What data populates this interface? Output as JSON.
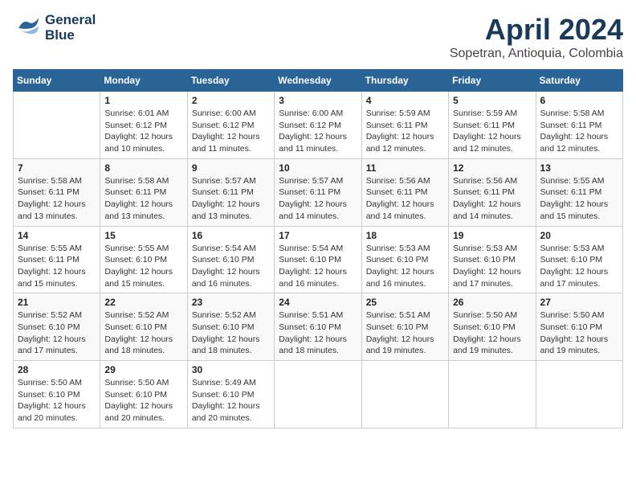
{
  "header": {
    "logo_line1": "General",
    "logo_line2": "Blue",
    "title": "April 2024",
    "subtitle": "Sopetran, Antioquia, Colombia"
  },
  "calendar": {
    "days_of_week": [
      "Sunday",
      "Monday",
      "Tuesday",
      "Wednesday",
      "Thursday",
      "Friday",
      "Saturday"
    ],
    "weeks": [
      [
        {
          "day": "",
          "info": ""
        },
        {
          "day": "1",
          "info": "Sunrise: 6:01 AM\nSunset: 6:12 PM\nDaylight: 12 hours\nand 10 minutes."
        },
        {
          "day": "2",
          "info": "Sunrise: 6:00 AM\nSunset: 6:12 PM\nDaylight: 12 hours\nand 11 minutes."
        },
        {
          "day": "3",
          "info": "Sunrise: 6:00 AM\nSunset: 6:12 PM\nDaylight: 12 hours\nand 11 minutes."
        },
        {
          "day": "4",
          "info": "Sunrise: 5:59 AM\nSunset: 6:11 PM\nDaylight: 12 hours\nand 12 minutes."
        },
        {
          "day": "5",
          "info": "Sunrise: 5:59 AM\nSunset: 6:11 PM\nDaylight: 12 hours\nand 12 minutes."
        },
        {
          "day": "6",
          "info": "Sunrise: 5:58 AM\nSunset: 6:11 PM\nDaylight: 12 hours\nand 12 minutes."
        }
      ],
      [
        {
          "day": "7",
          "info": "Sunrise: 5:58 AM\nSunset: 6:11 PM\nDaylight: 12 hours\nand 13 minutes."
        },
        {
          "day": "8",
          "info": "Sunrise: 5:58 AM\nSunset: 6:11 PM\nDaylight: 12 hours\nand 13 minutes."
        },
        {
          "day": "9",
          "info": "Sunrise: 5:57 AM\nSunset: 6:11 PM\nDaylight: 12 hours\nand 13 minutes."
        },
        {
          "day": "10",
          "info": "Sunrise: 5:57 AM\nSunset: 6:11 PM\nDaylight: 12 hours\nand 14 minutes."
        },
        {
          "day": "11",
          "info": "Sunrise: 5:56 AM\nSunset: 6:11 PM\nDaylight: 12 hours\nand 14 minutes."
        },
        {
          "day": "12",
          "info": "Sunrise: 5:56 AM\nSunset: 6:11 PM\nDaylight: 12 hours\nand 14 minutes."
        },
        {
          "day": "13",
          "info": "Sunrise: 5:55 AM\nSunset: 6:11 PM\nDaylight: 12 hours\nand 15 minutes."
        }
      ],
      [
        {
          "day": "14",
          "info": "Sunrise: 5:55 AM\nSunset: 6:11 PM\nDaylight: 12 hours\nand 15 minutes."
        },
        {
          "day": "15",
          "info": "Sunrise: 5:55 AM\nSunset: 6:10 PM\nDaylight: 12 hours\nand 15 minutes."
        },
        {
          "day": "16",
          "info": "Sunrise: 5:54 AM\nSunset: 6:10 PM\nDaylight: 12 hours\nand 16 minutes."
        },
        {
          "day": "17",
          "info": "Sunrise: 5:54 AM\nSunset: 6:10 PM\nDaylight: 12 hours\nand 16 minutes."
        },
        {
          "day": "18",
          "info": "Sunrise: 5:53 AM\nSunset: 6:10 PM\nDaylight: 12 hours\nand 16 minutes."
        },
        {
          "day": "19",
          "info": "Sunrise: 5:53 AM\nSunset: 6:10 PM\nDaylight: 12 hours\nand 17 minutes."
        },
        {
          "day": "20",
          "info": "Sunrise: 5:53 AM\nSunset: 6:10 PM\nDaylight: 12 hours\nand 17 minutes."
        }
      ],
      [
        {
          "day": "21",
          "info": "Sunrise: 5:52 AM\nSunset: 6:10 PM\nDaylight: 12 hours\nand 17 minutes."
        },
        {
          "day": "22",
          "info": "Sunrise: 5:52 AM\nSunset: 6:10 PM\nDaylight: 12 hours\nand 18 minutes."
        },
        {
          "day": "23",
          "info": "Sunrise: 5:52 AM\nSunset: 6:10 PM\nDaylight: 12 hours\nand 18 minutes."
        },
        {
          "day": "24",
          "info": "Sunrise: 5:51 AM\nSunset: 6:10 PM\nDaylight: 12 hours\nand 18 minutes."
        },
        {
          "day": "25",
          "info": "Sunrise: 5:51 AM\nSunset: 6:10 PM\nDaylight: 12 hours\nand 19 minutes."
        },
        {
          "day": "26",
          "info": "Sunrise: 5:50 AM\nSunset: 6:10 PM\nDaylight: 12 hours\nand 19 minutes."
        },
        {
          "day": "27",
          "info": "Sunrise: 5:50 AM\nSunset: 6:10 PM\nDaylight: 12 hours\nand 19 minutes."
        }
      ],
      [
        {
          "day": "28",
          "info": "Sunrise: 5:50 AM\nSunset: 6:10 PM\nDaylight: 12 hours\nand 20 minutes."
        },
        {
          "day": "29",
          "info": "Sunrise: 5:50 AM\nSunset: 6:10 PM\nDaylight: 12 hours\nand 20 minutes."
        },
        {
          "day": "30",
          "info": "Sunrise: 5:49 AM\nSunset: 6:10 PM\nDaylight: 12 hours\nand 20 minutes."
        },
        {
          "day": "",
          "info": ""
        },
        {
          "day": "",
          "info": ""
        },
        {
          "day": "",
          "info": ""
        },
        {
          "day": "",
          "info": ""
        }
      ]
    ]
  }
}
